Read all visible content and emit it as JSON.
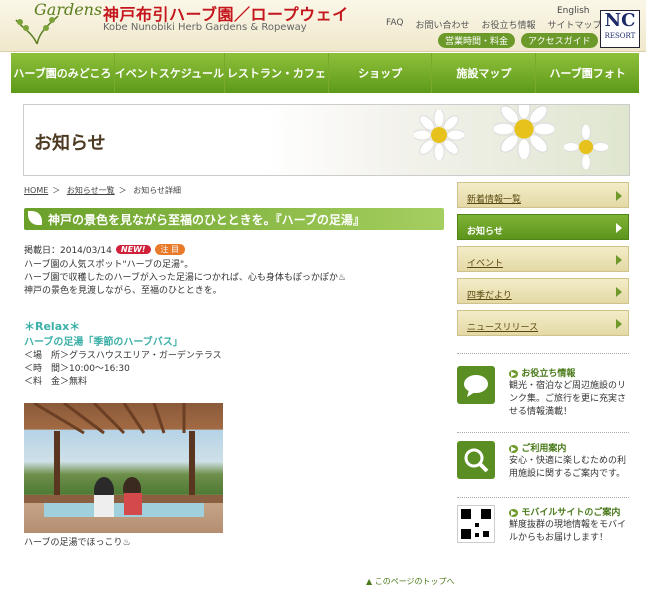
{
  "header": {
    "logo_text": "Gardens",
    "title": "神戸布引ハーブ園／ロープウェイ",
    "subtitle": "Kobe Nunobiki Herb Gardens & Ropeway",
    "lang": "English",
    "util_links": [
      "FAQ",
      "お問い合わせ",
      "お役立ち情報",
      "サイトマップ"
    ],
    "pills": [
      "営業時間・料金",
      "アクセスガイド"
    ],
    "nc_logo": {
      "big": "NC",
      "small": "RESORT"
    }
  },
  "nav": [
    "ハーブ園のみどころ",
    "イベントスケジュール",
    "レストラン・カフェ",
    "ショップ",
    "施設マップ",
    "ハーブ園フォト"
  ],
  "banner": {
    "title": "お知らせ"
  },
  "breadcrumb": [
    "HOME",
    "お知らせ一覧",
    "お知らせ詳細"
  ],
  "article": {
    "title": "神戸の景色を見ながら至福のひとときを。『ハーブの足湯』",
    "date": "掲載日：2014/03/14",
    "badge_new": "NEW!",
    "badge_cat": "注 目",
    "body": [
      "ハーブ園の人気スポット\"ハーブの足湯\"。",
      "ハーブ園で収穫したのハーブが入った足湯につかれば、心も身体もぽっかぽか♨",
      "神戸の景色を見渡しながら、至福のひとときを。"
    ],
    "relax": "＊Relax＊",
    "footbath_title": "ハーブの足湯「季節のハーブバス」",
    "info": [
      "＜場　所＞グラスハウスエリア・ガーデンテラス",
      "＜時　間＞10:00〜16:30",
      "＜料　金＞無料"
    ],
    "photo_caption": "ハーブの足湯でほっこり♨"
  },
  "pagetop": "このページのトップへ",
  "side_menu": [
    {
      "label": "新着情報一覧",
      "active": false
    },
    {
      "label": "お知らせ",
      "active": true
    },
    {
      "label": "イベント",
      "active": false
    },
    {
      "label": "四季だより",
      "active": false
    },
    {
      "label": "ニュースリリース",
      "active": false
    }
  ],
  "side_boxes": [
    {
      "title": "お役立ち情報",
      "desc": "観光・宿泊など周辺施設のリンク集。ご旅行を更に充実させる情報満載！"
    },
    {
      "title": "ご利用案内",
      "desc": "安心・快適に楽しむための利用施設に関するご案内です。"
    },
    {
      "title": "モバイルサイトのご案内",
      "desc": "鮮度抜群の現地情報をモバイルからもお届けします！"
    }
  ]
}
